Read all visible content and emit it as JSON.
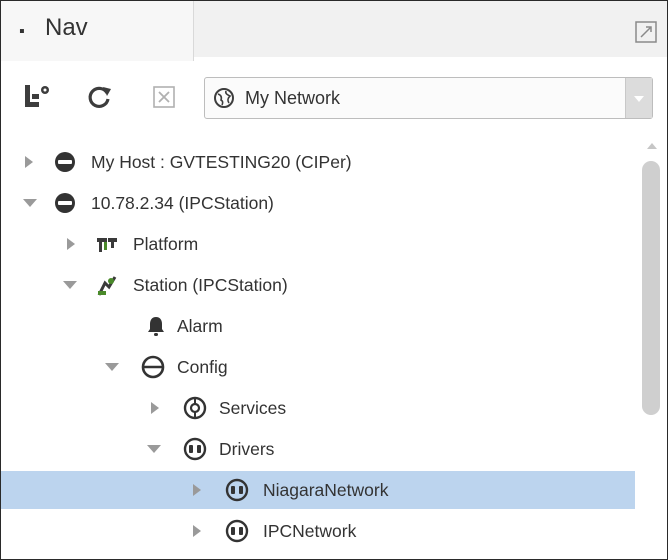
{
  "panel": {
    "tab_title": "Nav",
    "tab_icon": "dropdown-dot-icon",
    "expand_icon": "expand-icon"
  },
  "toolbar": {
    "icons": [
      "tree-settings-icon",
      "refresh-icon",
      "close-icon"
    ],
    "select": {
      "value": "My Network",
      "icon": "globe-icon"
    }
  },
  "tree": {
    "rows": [
      {
        "label": "My Host : GVTESTING20 (CIPer)",
        "state": "collapsed",
        "icon": "host-icon"
      },
      {
        "label": "10.78.2.34 (IPCStation)",
        "state": "expanded",
        "icon": "host-icon"
      },
      {
        "label": "Platform",
        "state": "collapsed",
        "icon": "platform-icon"
      },
      {
        "label": "Station (IPCStation)",
        "state": "expanded",
        "icon": "station-icon"
      },
      {
        "label": "Alarm",
        "state": "none",
        "icon": "bell-icon"
      },
      {
        "label": "Config",
        "state": "expanded",
        "icon": "database-icon"
      },
      {
        "label": "Services",
        "state": "collapsed",
        "icon": "services-icon"
      },
      {
        "label": "Drivers",
        "state": "expanded",
        "icon": "drivers-icon"
      },
      {
        "label": "NiagaraNetwork",
        "state": "collapsed",
        "icon": "network-icon",
        "selected": true
      },
      {
        "label": "IPCNetwork",
        "state": "collapsed",
        "icon": "network-icon"
      }
    ]
  },
  "colors": {
    "selection": "#bcd4ee",
    "text": "#333333",
    "icon": "#3a3a3a",
    "platform_green": "#4a8a2a"
  }
}
